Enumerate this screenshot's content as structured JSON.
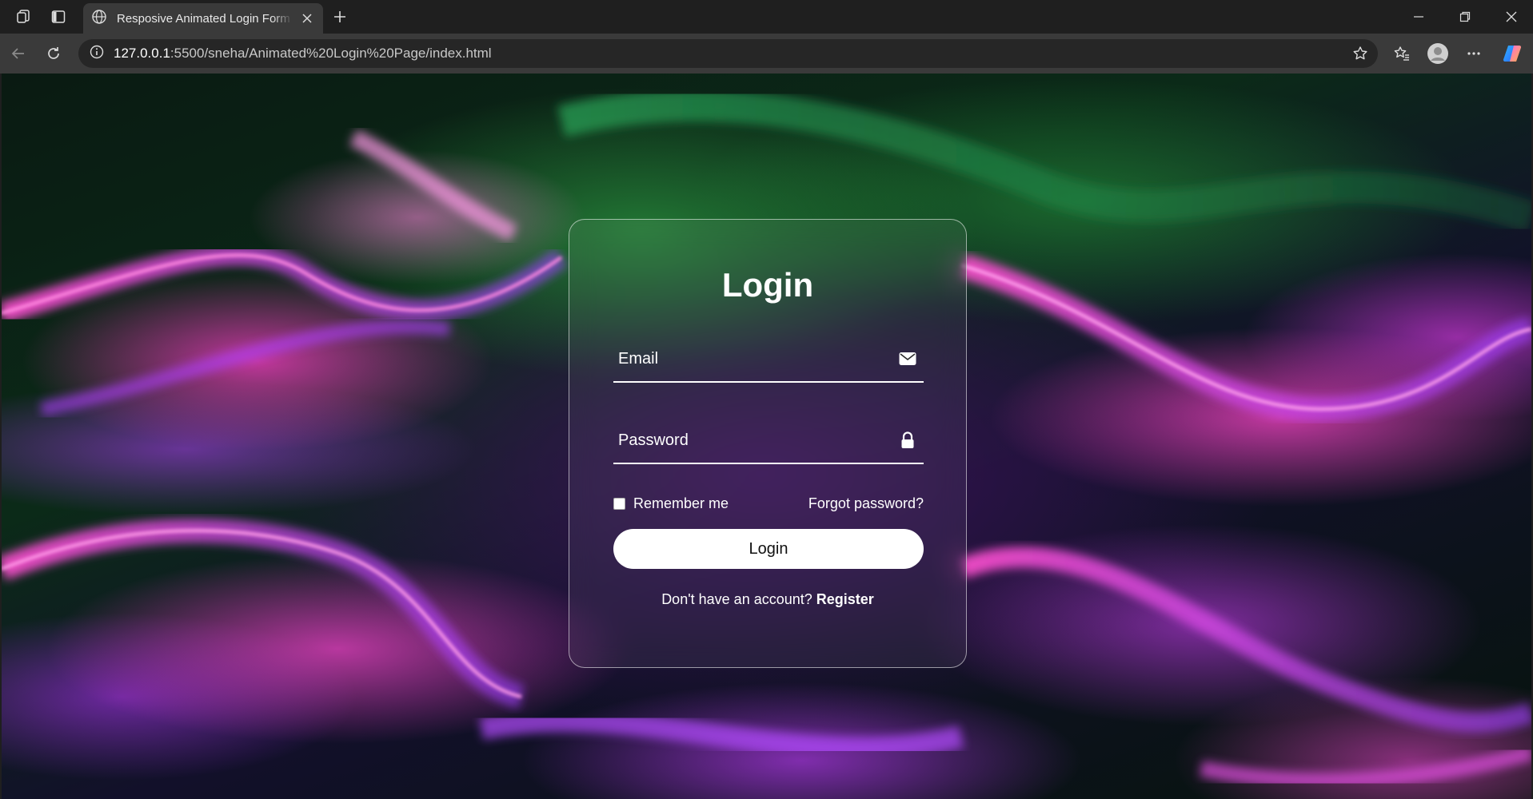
{
  "browser": {
    "tab_title": "Resposive Animated Login Form u",
    "url_host": "127.0.0.1",
    "url_rest": ":5500/sneha/Animated%20Login%20Page/index.html"
  },
  "login": {
    "title": "Login",
    "email_placeholder": "Email",
    "password_placeholder": "Password",
    "remember_label": "Remember me",
    "forgot_label": "Forgot password?",
    "button_label": "Login",
    "no_account_text": "Don't have an account?",
    "register_label": "Register"
  },
  "icons": {
    "email": "envelope-icon",
    "password": "lock-icon"
  },
  "colors": {
    "accent": "#ffffff",
    "button_text": "#111111",
    "chrome_dark": "#1f1f1f",
    "chrome_mid": "#3a3a3a"
  }
}
